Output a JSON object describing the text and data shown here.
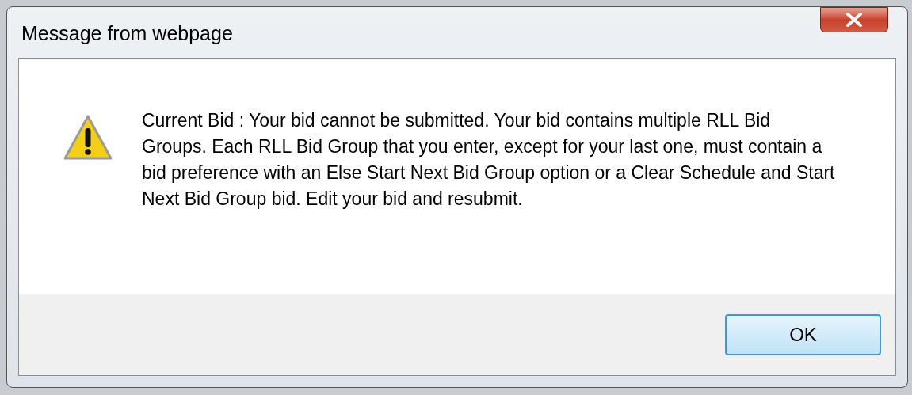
{
  "window": {
    "title": "Message from webpage"
  },
  "message": "Current Bid : Your bid cannot be submitted. Your bid contains multiple RLL Bid Groups. Each RLL Bid Group that you enter, except for your last one, must contain a bid preference with an Else Start Next Bid Group option or a Clear Schedule and Start Next Bid Group bid. Edit your bid and resubmit.",
  "buttons": [
    {
      "label": "OK"
    }
  ]
}
